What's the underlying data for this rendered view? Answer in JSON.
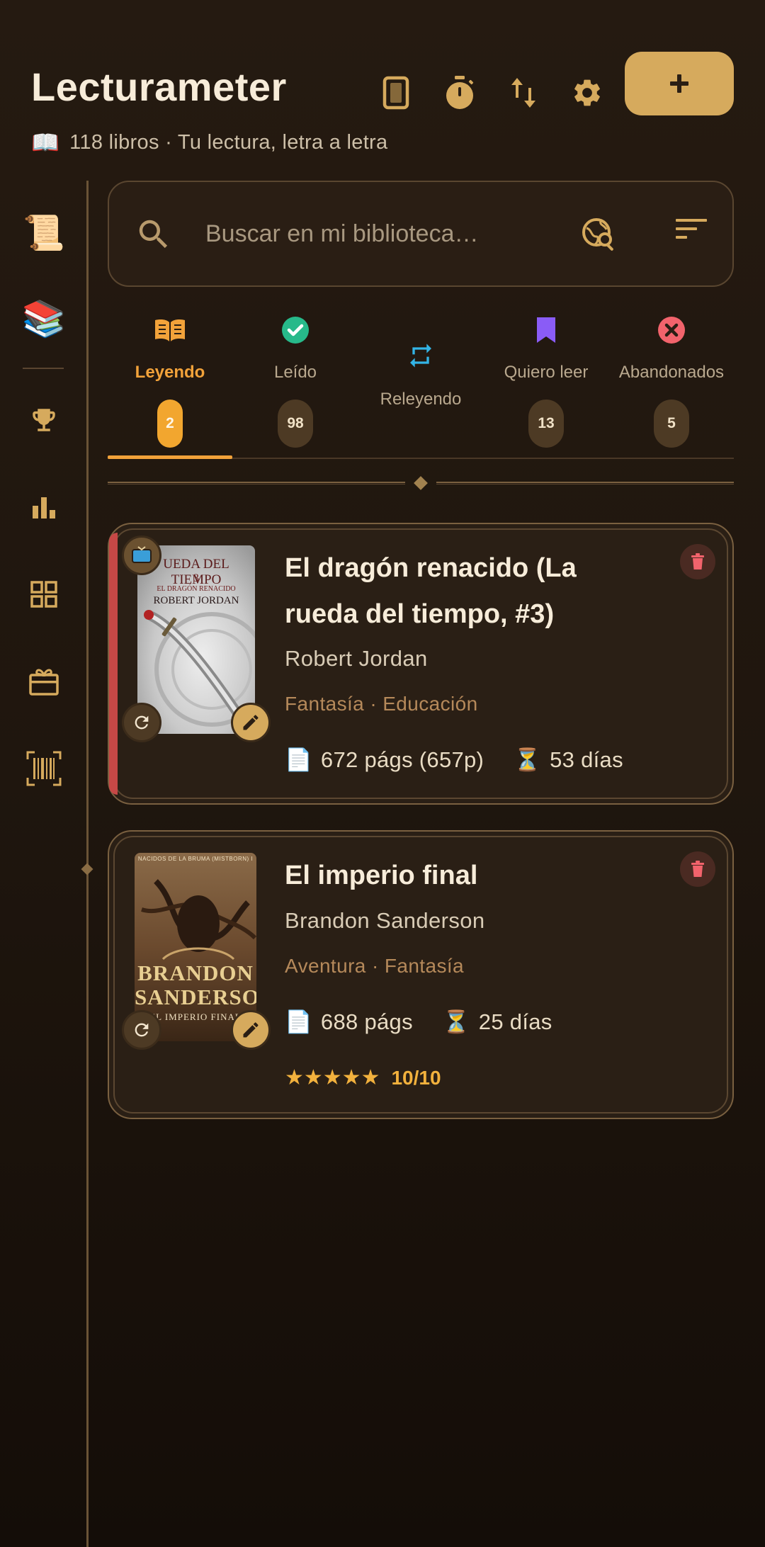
{
  "header": {
    "title": "Lecturameter",
    "subtitle_icon": "📖",
    "subtitle": "118 libros · Tu lectura, letra a letra",
    "icons": [
      "book-card-icon",
      "stopwatch-icon",
      "sort-arrows-icon",
      "gear-icon"
    ],
    "add_label": "+"
  },
  "sidebar": {
    "items": [
      {
        "name": "scroll-icon",
        "glyph": "📜"
      },
      {
        "name": "books-icon",
        "glyph": "📚"
      },
      {
        "name": "trophy-icon"
      },
      {
        "name": "bar-chart-icon"
      },
      {
        "name": "grid-icon"
      },
      {
        "name": "gift-icon"
      },
      {
        "name": "barcode-scan-icon"
      }
    ]
  },
  "search": {
    "placeholder": "Buscar en mi biblioteca…"
  },
  "tabs": [
    {
      "label": "Leyendo",
      "count": "2",
      "active": true,
      "icon": "open-book-icon"
    },
    {
      "label": "Leído",
      "count": "98",
      "icon": "check-circle-icon"
    },
    {
      "label": "Releyendo",
      "count": "",
      "icon": "repeat-icon"
    },
    {
      "label": "Quiero leer",
      "count": "13",
      "icon": "bookmark-icon"
    },
    {
      "label": "Abandonados",
      "count": "5",
      "icon": "cancel-circle-icon"
    }
  ],
  "books": [
    {
      "title_line1": "El dragón renacido (La",
      "title_line2": "rueda del tiempo, #3)",
      "author": "Robert Jordan",
      "genres": "Fantasía · Educación",
      "pages_icon": "📄",
      "pages": "672 págs (657p)",
      "days_icon": "⏳",
      "days": "53 días",
      "cover_text_top": "UEDA DEL TIEMPO",
      "cover_text_mid": "EL DRAGÓN RENACIDO",
      "cover_text_author": "ROBERT JORDAN",
      "cover_num": "3"
    },
    {
      "title": "El imperio final",
      "author": "Brandon Sanderson",
      "genres": "Aventura · Fantasía",
      "pages_icon": "📄",
      "pages": "688 págs",
      "days_icon": "⏳",
      "days": "25 días",
      "stars": "★★★★★",
      "rating_value": 10,
      "score": "10/10",
      "cover_text_top": "NACIDOS DE LA BRUMA (MISTBORN) I",
      "cover_text_author1": "BRANDON",
      "cover_text_author2": "SANDERSON",
      "cover_text_sub": "EL IMPERIO FINAL"
    }
  ],
  "colors": {
    "accent": "#d6aa5d",
    "active_tab": "#f2a23a",
    "reading_bar": "#c64846",
    "check_green": "#27b98a",
    "repeat_blue": "#33b4e6",
    "bookmark_purple": "#8a5cf6",
    "cancel_red": "#f2636c"
  }
}
